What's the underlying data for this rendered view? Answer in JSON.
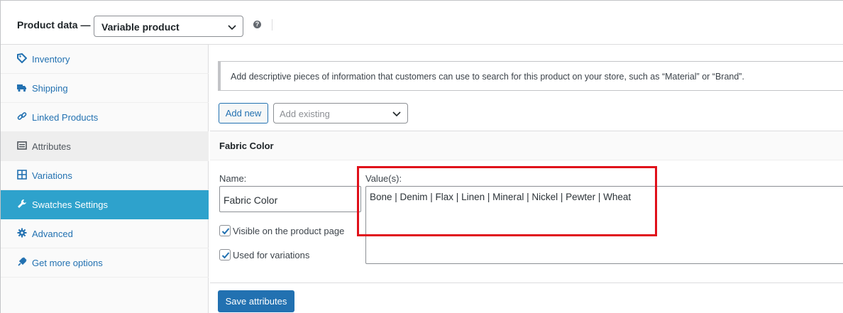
{
  "header": {
    "title": "Product data —",
    "product_type": "Variable product",
    "help": "?"
  },
  "sidebar": {
    "items": [
      {
        "label": "Inventory",
        "icon": "tag-icon"
      },
      {
        "label": "Shipping",
        "icon": "truck-icon"
      },
      {
        "label": "Linked Products",
        "icon": "link-icon"
      },
      {
        "label": "Attributes",
        "icon": "list-icon",
        "state": "selected"
      },
      {
        "label": "Variations",
        "icon": "grid-icon"
      },
      {
        "label": "Swatches Settings",
        "icon": "wrench-icon",
        "state": "highlighted"
      },
      {
        "label": "Advanced",
        "icon": "gear-icon"
      },
      {
        "label": "Get more options",
        "icon": "plugin-icon"
      }
    ]
  },
  "main": {
    "notice": "Add descriptive pieces of information that customers can use to search for this product on your store, such as “Material” or “Brand”.",
    "add_new_label": "Add new",
    "add_existing_placeholder": "Add existing",
    "attribute": {
      "heading": "Fabric Color",
      "name_label": "Name:",
      "name_value": "Fabric Color",
      "values_label": "Value(s):",
      "values_value": "Bone | Denim | Flax | Linen | Mineral | Nickel | Pewter | Wheat",
      "visible_label": "Visible on the product page",
      "visible_checked": true,
      "variations_label": "Used for variations",
      "variations_checked": true
    },
    "save_label": "Save attributes"
  },
  "colors": {
    "accent": "#2271b1",
    "active_tab": "#2ea2cc",
    "highlight_box": "#e0101a"
  }
}
